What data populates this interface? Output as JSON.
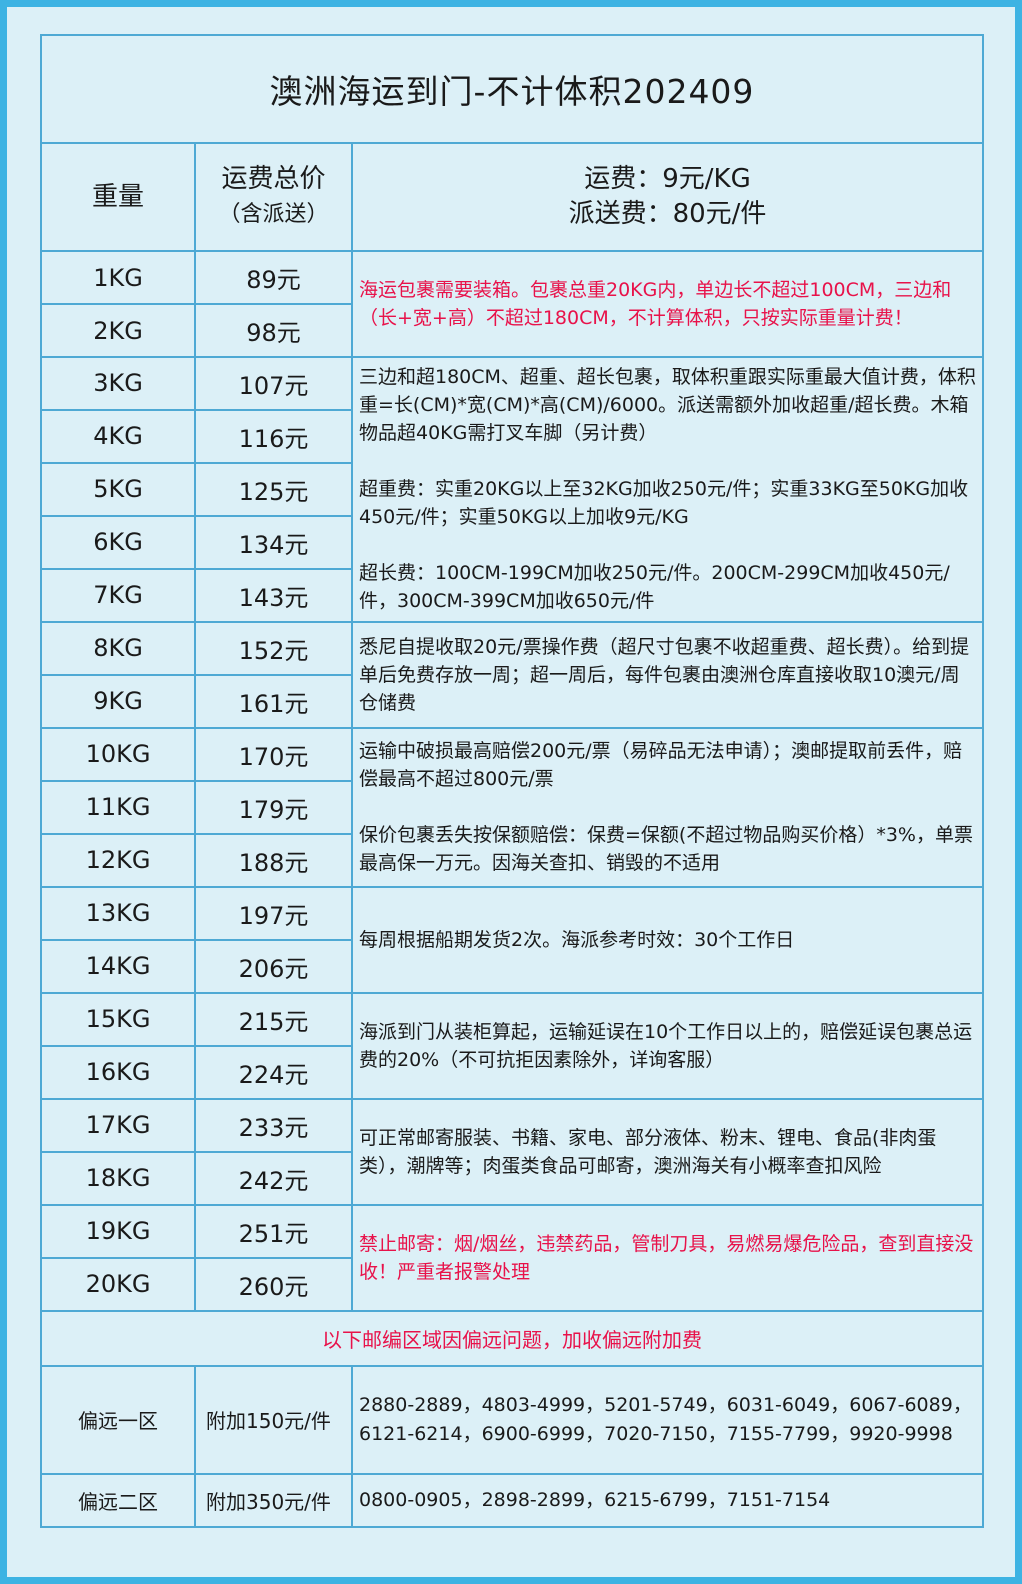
{
  "title": "澳洲海运到门-不计体积202409",
  "header": {
    "weight": "重量",
    "price_line1": "运费总价",
    "price_line2": "（含派送）",
    "rate_line1": "运费：9元/KG",
    "rate_line2": "派送费：80元/件"
  },
  "rows": [
    {
      "weight": "1KG",
      "price": "89元"
    },
    {
      "weight": "2KG",
      "price": "98元"
    },
    {
      "weight": "3KG",
      "price": "107元"
    },
    {
      "weight": "4KG",
      "price": "116元"
    },
    {
      "weight": "5KG",
      "price": "125元"
    },
    {
      "weight": "6KG",
      "price": "134元"
    },
    {
      "weight": "7KG",
      "price": "143元"
    },
    {
      "weight": "8KG",
      "price": "152元"
    },
    {
      "weight": "9KG",
      "price": "161元"
    },
    {
      "weight": "10KG",
      "price": "170元"
    },
    {
      "weight": "11KG",
      "price": "179元"
    },
    {
      "weight": "12KG",
      "price": "188元"
    },
    {
      "weight": "13KG",
      "price": "197元"
    },
    {
      "weight": "14KG",
      "price": "206元"
    },
    {
      "weight": "15KG",
      "price": "215元"
    },
    {
      "weight": "16KG",
      "price": "224元"
    },
    {
      "weight": "17KG",
      "price": "233元"
    },
    {
      "weight": "18KG",
      "price": "242元"
    },
    {
      "weight": "19KG",
      "price": "251元"
    },
    {
      "weight": "20KG",
      "price": "260元"
    }
  ],
  "notes": {
    "packing": "海运包裹需要装箱。包裹总重20KG内，单边长不超过100CM，三边和（长+宽+高）不超过180CM，不计算体积，只按实际重量计费！",
    "oversize_1": "三边和超180CM、超重、超长包裹，取体积重跟实际重最大值计费，体积重=长(CM)*宽(CM)*高(CM)/6000。派送需额外加收超重/超长费。木箱物品超40KG需打叉车脚（另计费）",
    "oversize_2": "超重费：实重20KG以上至32KG加收250元/件；实重33KG至50KG加收450元/件；实重50KG以上加收9元/KG",
    "oversize_3": "超长费：100CM-199CM加收250元/件。200CM-299CM加收450元/件，300CM-399CM加收650元/件",
    "sydney": "悉尼自提收取20元/票操作费（超尺寸包裹不收超重费、超长费）。给到提单后免费存放一周；超一周后，每件包裹由澳洲仓库直接收取10澳元/周仓储费",
    "damage_1": "运输中破损最高赔偿200元/票（易碎品无法申请）；澳邮提取前丢件，赔偿最高不超过800元/票",
    "damage_2": "保价包裹丢失按保额赔偿：保费=保额(不超过物品购买价格）*3%，单票最高保一万元。因海关查扣、销毁的不适用",
    "schedule": "每周根据船期发货2次。海派参考时效：30个工作日",
    "delay": "海派到门从装柜算起，运输延误在10个工作日以上的，赔偿延误包裹总运费的20%（不可抗拒因素除外，详询客服）",
    "allowed": "可正常邮寄服装、书籍、家电、部分液体、粉末、锂电、食品(非肉蛋类），潮牌等；肉蛋类食品可邮寄，澳洲海关有小概率查扣风险",
    "forbidden": "禁止邮寄：烟/烟丝，违禁药品，管制刀具，易燃易爆危险品，查到直接没收！严重者报警处理"
  },
  "remote": {
    "banner": "以下邮编区域因偏远问题，加收偏远附加费",
    "zone1_label": "偏远一区",
    "zone1_fee": "附加150元/件",
    "zone1_codes": "2880-2889，4803-4999，5201-5749，6031-6049，6067-6089，6121-6214，6900-6999，7020-7150，7155-7799，9920-9998",
    "zone2_label": "偏远二区",
    "zone2_fee": "附加350元/件",
    "zone2_codes": "0800-0905，2898-2899，6215-6799，7151-7154"
  },
  "colors": {
    "background": "#dcf0f7",
    "border": "#4ea9d4",
    "frame": "#3db3e3",
    "highlight_red": "#e8124a"
  }
}
